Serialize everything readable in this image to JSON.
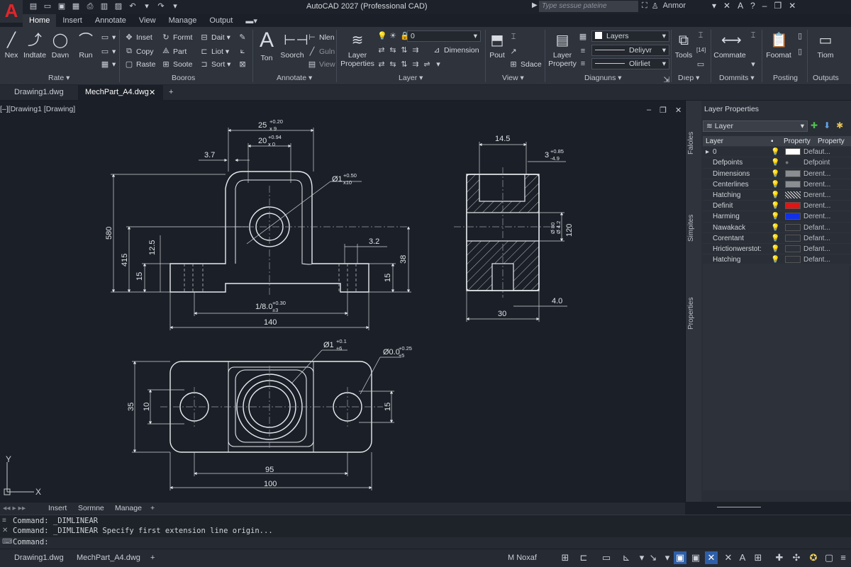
{
  "app": {
    "logo": "A",
    "title": "AutoCAD 2027 (Professional CAD)",
    "search_placeholder": "Type sessue pateine",
    "user": "Anmor"
  },
  "ribbon_tabs": [
    "Home",
    "Insert",
    "Annotate",
    "View",
    "Manage",
    "Output"
  ],
  "ribbon": {
    "draw": {
      "buttons": [
        "Nex",
        "Indtate",
        "Davn",
        "Run"
      ],
      "panel": "Rate ▾"
    },
    "modify": {
      "col1": [
        "Inset",
        "Copy",
        "Raste"
      ],
      "col2": [
        "Formt",
        "Part",
        "Soote"
      ],
      "col3": [
        "Dait ▾",
        "Liot ▾",
        "Sort ▾"
      ],
      "panel": "Booros"
    },
    "annotate": {
      "buttons": [
        "Ton",
        "Soorch"
      ],
      "small": [
        "Nlen",
        "Guln",
        "View"
      ],
      "panel": "Annotate ▾"
    },
    "layer": {
      "big": [
        "Layer",
        "Properties"
      ],
      "dropdown": "0",
      "dimension": "Dimension",
      "panel": "Layer ▾"
    },
    "view": {
      "buttons": [
        "Pout"
      ],
      "small": [
        "Sdace"
      ],
      "panel": "View ▾"
    },
    "properties": {
      "big": [
        "Layer",
        "Property"
      ],
      "dd1": "Layers",
      "dd2": "Deliyvr",
      "dd3": "Olirliet",
      "panel": "Diagnuns ▾"
    },
    "tools": {
      "buttons": [
        "Tools"
      ],
      "panel": "Dıep ▾"
    },
    "commate": {
      "buttons": [
        "Commate"
      ],
      "panel": "Dommits ▾"
    },
    "format": {
      "buttons": [
        "Foomat"
      ],
      "panel": "Posting"
    },
    "tiom": {
      "buttons": [
        "Tiom"
      ],
      "panel": "Outputs"
    }
  },
  "doc_tabs": [
    "Drawing1.dwg",
    "MechPart_A4.dwg"
  ],
  "viewport_label": "[–][Drawing1 [Drawing]",
  "drawing": {
    "front": {
      "d_25": "25",
      "d_25_tol": "+0.20",
      "d_25_tol2": "x 9",
      "d_20": "20",
      "d_20_tol": "+0.94",
      "d_20_tol2": "x 0",
      "d_37": "3.7",
      "d_dia": "Ø1",
      "d_dia_tol": "+0.50",
      "d_dia_tol2": "x10",
      "d_32": "3.2",
      "d_580": "580",
      "d_415": "415",
      "d_125": "12.5",
      "d_15a": "15",
      "d_15b": "15",
      "d_38": "38",
      "d_180": "1/8.0",
      "d_180_tol": "+0.30",
      "d_180_tol2": "±3",
      "d_140": "140"
    },
    "side": {
      "d_145": "14.5",
      "d_3": "3",
      "d_3_tol": "+0.85",
      "d_3_tol2": "-4.9",
      "d_120": "120",
      "d_small": "Ø 80",
      "d_small2": "Ø 4.2",
      "d_40": "4.0",
      "d_30": "30"
    },
    "top": {
      "d_dia1": "Ø1",
      "d_dia1_tol": "+0.1",
      "d_dia1_tol2": "±6",
      "d_dia2": "Ø0.0",
      "d_dia2_tol": "+0.25",
      "d_dia2_tol2": "±5",
      "d_35": "35",
      "d_10": "10",
      "d_15": "15",
      "d_95": "95",
      "d_100": "100"
    },
    "ucs_y": "Y",
    "ucs_x": "X"
  },
  "layer_panel": {
    "title": "Layer Properties",
    "dropdown": "Layer",
    "side_tabs": [
      "Faloles",
      "Simpites",
      "Properties"
    ],
    "headers": [
      "Layer",
      "Property",
      "Property"
    ],
    "rows": [
      {
        "name": "0",
        "swatch": "#ffffff",
        "value": "Defaut..."
      },
      {
        "name": "Defpoints",
        "swatch": "",
        "value": "Defpoint"
      },
      {
        "name": "Dimensions",
        "swatch": "#8a8d92",
        "value": "Derent..."
      },
      {
        "name": "Centerlines",
        "swatch": "#8a8d92",
        "value": "Derent..."
      },
      {
        "name": "Hatching",
        "swatch": "hatch",
        "value": "Derent..."
      },
      {
        "name": "Definit",
        "swatch": "#e21414",
        "value": "Derent..."
      },
      {
        "name": "Harming",
        "swatch": "#1230e6",
        "value": "Derent..."
      },
      {
        "name": "Nawakack",
        "swatch": "#2c3038",
        "value": "Defant..."
      },
      {
        "name": "Corentant",
        "swatch": "#2c3038",
        "value": "Defant..."
      },
      {
        "name": "Hrictionwerstot:",
        "swatch": "#2c3038",
        "value": "Defant..."
      },
      {
        "name": "Hatching",
        "swatch": "#2c3038",
        "value": "Defant..."
      }
    ]
  },
  "layout_tabs": [
    "Insert",
    "Sormne",
    "Manage"
  ],
  "command": {
    "line1": "Command: _DIMLINEAR",
    "line2": "Command: _DIMLINEAR Specify first extension line origin...",
    "prompt": "Command:"
  },
  "bottom_tabs": [
    "Drawing1.dwg",
    "MechPart_A4.dwg"
  ],
  "status": {
    "model": "M Noxaf"
  }
}
